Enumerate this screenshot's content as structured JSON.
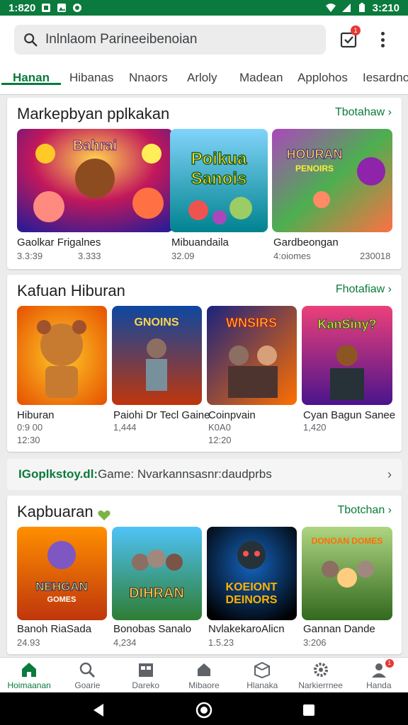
{
  "status_bar": {
    "time_left": "1:820",
    "time_right": "3:210"
  },
  "search": {
    "placeholder": "Inlnlaom Parineeibenoian"
  },
  "header": {
    "cart_badge": "1"
  },
  "tabs": [
    {
      "label": "Hanan"
    },
    {
      "label": "Hibanas"
    },
    {
      "label": "Nnaors"
    },
    {
      "label": "Arloly"
    },
    {
      "label": "Madean"
    },
    {
      "label": "Applohos"
    },
    {
      "label": "Iesardnos"
    }
  ],
  "section1": {
    "title": "Markepbyan pplkakan",
    "link": "Tbotahaw",
    "items": [
      {
        "name": "Gaolkar Frigalnes",
        "meta1": "3.3:39",
        "meta2": "3.333"
      },
      {
        "name": "Mibuandaila",
        "meta1": "32.09",
        "meta2": ""
      },
      {
        "name": "Gardbeongan",
        "meta1": "4:oiomes",
        "meta2": "230018"
      }
    ]
  },
  "section2": {
    "title": "Kafuan Hiburan",
    "link": "Fhotafiaw",
    "items": [
      {
        "name": "Hiburan",
        "meta1": "0:9 00",
        "meta2": "12:30"
      },
      {
        "name": "Paiohi Dr Tecl Gaine",
        "meta1": "1,444",
        "meta2": ""
      },
      {
        "name": "Coinpvain",
        "meta1": "K0A0",
        "meta2": "12:20"
      },
      {
        "name": "Cyan Bagun Sanee",
        "meta1": "1,420",
        "meta2": ""
      }
    ]
  },
  "promo": {
    "prefix": "IGoplkstoy.dl:",
    "text": " Game: Nvarkannsasnr:daudprbs"
  },
  "section3": {
    "title": "Kapbuaran",
    "link": "Tbotchan",
    "items": [
      {
        "name": "Banoh RiaSada",
        "meta1": "24.93"
      },
      {
        "name": "Bonobas Sanalo",
        "meta1": "4,234"
      },
      {
        "name": "NvlakekaroAlicn",
        "meta1": "1.5.23"
      },
      {
        "name": "Gannan Dande",
        "meta1": "3:206"
      }
    ]
  },
  "bottom_nav": [
    {
      "label": "Hoimaanan",
      "icon": "home-icon"
    },
    {
      "label": "Goarie",
      "icon": "search-icon"
    },
    {
      "label": "Dareko",
      "icon": "library-icon"
    },
    {
      "label": "Mibaore",
      "icon": "store-icon"
    },
    {
      "label": "Hlanaka",
      "icon": "box-icon"
    },
    {
      "label": "Narkierrnee",
      "icon": "gear-icon"
    },
    {
      "label": "Handa",
      "icon": "profile-icon"
    }
  ],
  "bottom_badge": "1",
  "colors": {
    "brand_green": "#0b7a3d",
    "badge_red": "#e53935"
  }
}
